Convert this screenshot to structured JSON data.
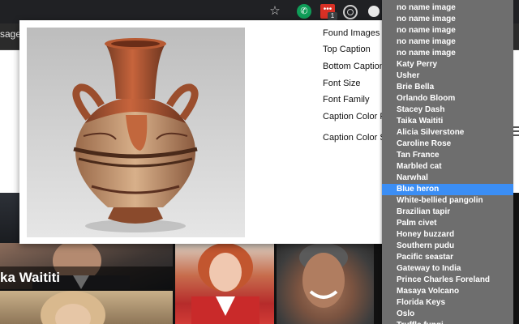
{
  "toolbar": {
    "extension_badge": "1"
  },
  "page": {
    "tab_text": "sages",
    "photo_caption": "ka Waititi"
  },
  "popup": {
    "settings": [
      "Found Images",
      "Top Caption",
      "Bottom Caption",
      "Font Size",
      "Font Family",
      "Caption Color Fill",
      "Caption Color Stroke"
    ]
  },
  "dropdown": {
    "selected": "Blue heron",
    "options": [
      "no name image",
      "no name image",
      "no name image",
      "no name image",
      "no name image",
      "Katy Perry",
      "Usher",
      "Brie Bella",
      "Orlando Bloom",
      "Stacey Dash",
      "Taika Waititi",
      "Alicia Silverstone",
      "Caroline Rose",
      "Tan France",
      "Marbled cat",
      "Narwhal",
      "Blue heron",
      "White-bellied pangolin",
      "Brazilian tapir",
      "Palm civet",
      "Honey buzzard",
      "Southern pudu",
      "Pacific seastar",
      "Gateway to India",
      "Prince Charles Foreland",
      "Masaya Volcano",
      "Florida Keys",
      "Oslo",
      "Truffle fungi"
    ]
  },
  "colors": {
    "dropdown_bg": "#6e6e6e",
    "selected_bg": "#3b8ef5",
    "toolbar_bg": "#202124"
  }
}
